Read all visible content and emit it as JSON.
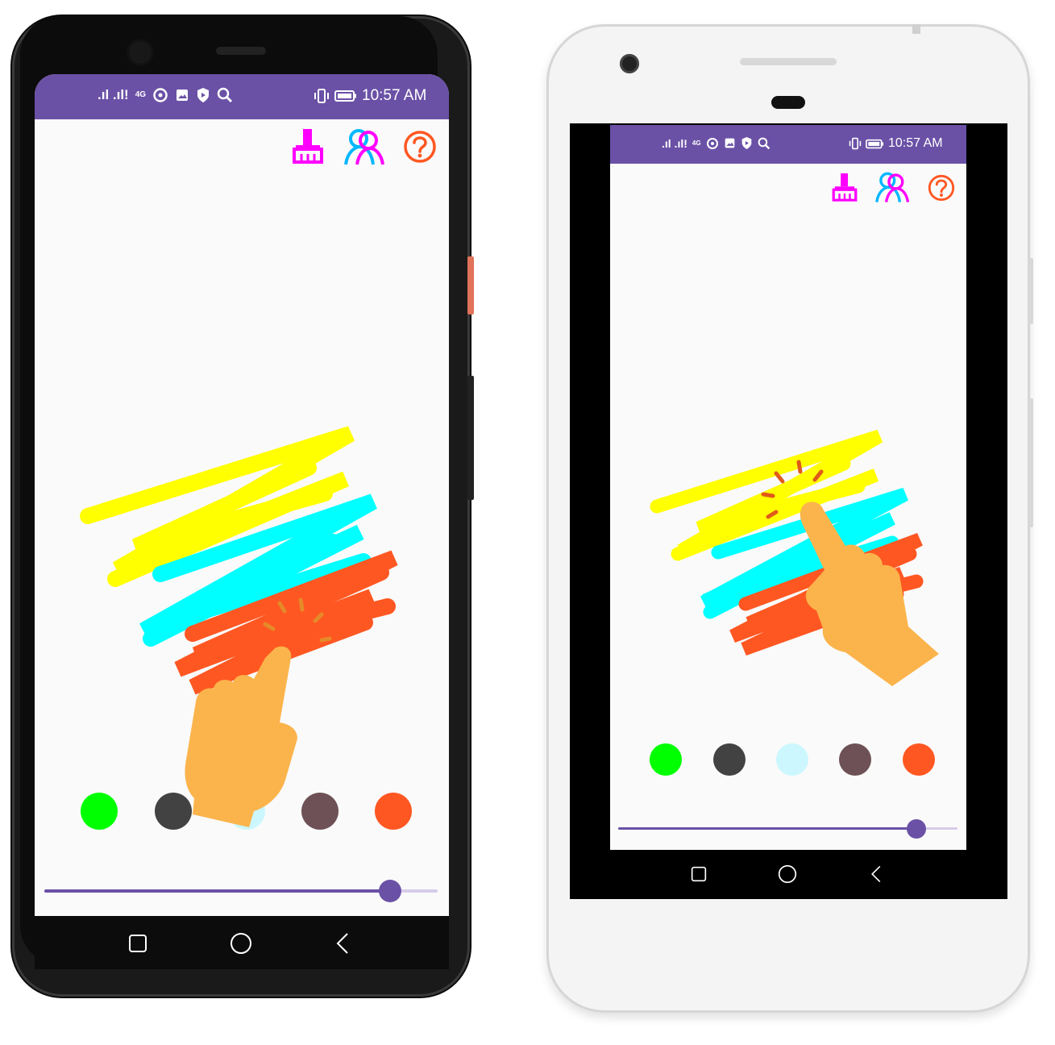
{
  "status_bar": {
    "signal_text": ".ıl .ıl!",
    "network": "4G",
    "time": "10:57 AM"
  },
  "toolbar": {
    "icons": [
      "clear-brush-icon",
      "users-icon",
      "help-icon"
    ],
    "colors": {
      "brush": "#ff00ff",
      "users_a": "#00b7ff",
      "users_b": "#ff00ff",
      "help": "#ff5722"
    }
  },
  "palette": {
    "colors": [
      "#00ff00",
      "#424242",
      "#ccf7ff",
      "#6d5156",
      "#ff5722"
    ],
    "names": [
      "green",
      "dark-gray",
      "light-cyan",
      "brown",
      "orange"
    ]
  },
  "stroke_slider": {
    "value_fraction": 0.88,
    "track_color": "#6a51a6"
  },
  "theme": {
    "appbar": "#6a51a6",
    "canvas": "#fafafa",
    "scribble_yellow": "#ffff00",
    "scribble_cyan": "#00ffff",
    "scribble_orange": "#ff5722",
    "hand": "#fbb44c"
  },
  "navigation": {
    "buttons": [
      "recent-apps-icon",
      "home-icon",
      "back-icon"
    ]
  }
}
